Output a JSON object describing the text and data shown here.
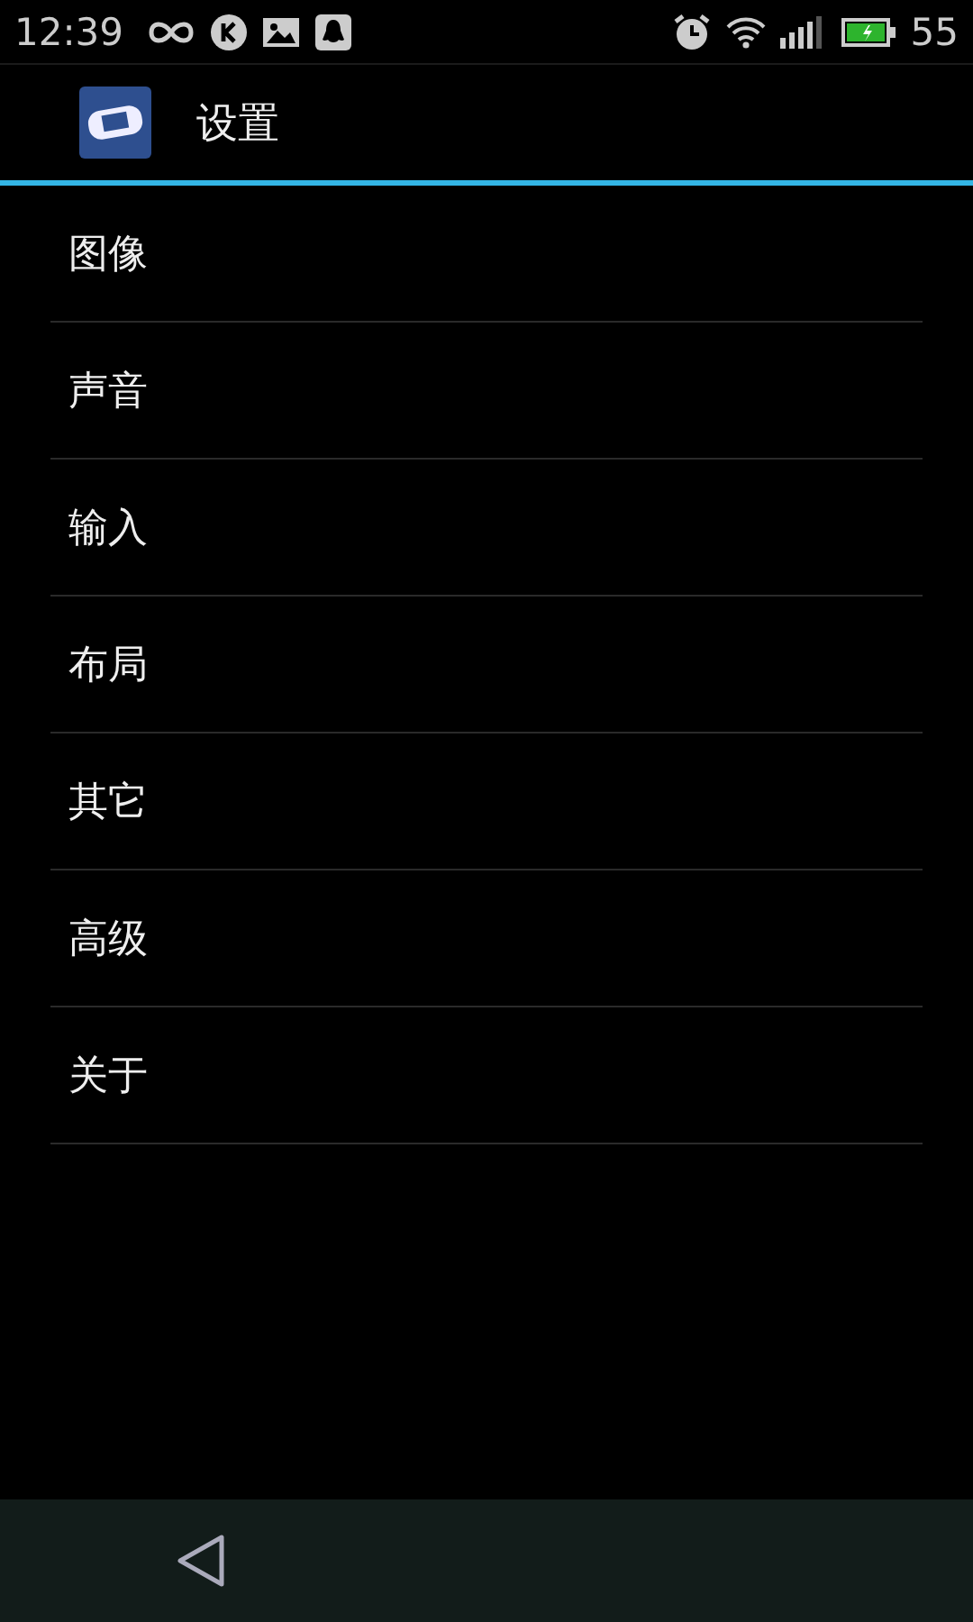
{
  "status_bar": {
    "time": "12:39",
    "battery": "55"
  },
  "app_bar": {
    "title": "设置"
  },
  "menu": [
    {
      "label": "图像"
    },
    {
      "label": "声音"
    },
    {
      "label": "输入"
    },
    {
      "label": "布局"
    },
    {
      "label": "其它"
    },
    {
      "label": "高级"
    },
    {
      "label": "关于"
    }
  ]
}
